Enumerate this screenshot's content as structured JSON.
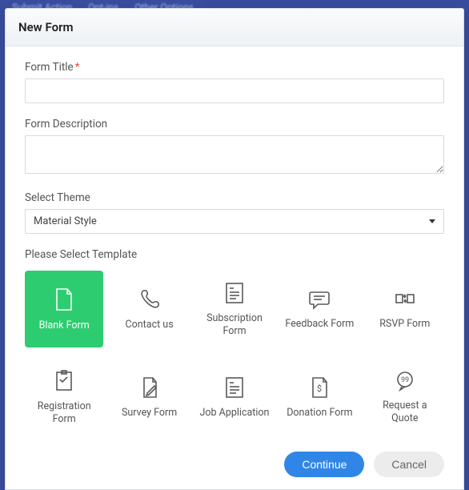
{
  "header": {
    "title": "New Form"
  },
  "fields": {
    "title": {
      "label": "Form Title",
      "required_mark": "*",
      "value": ""
    },
    "description": {
      "label": "Form Description",
      "value": ""
    },
    "theme": {
      "label": "Select Theme",
      "selected": "Material Style"
    }
  },
  "templates": {
    "label": "Please Select Template",
    "items": [
      {
        "label": "Blank Form",
        "selected": true
      },
      {
        "label": "Contact us",
        "selected": false
      },
      {
        "label": "Subscription Form",
        "selected": false
      },
      {
        "label": "Feedback Form",
        "selected": false
      },
      {
        "label": "RSVP Form",
        "selected": false
      },
      {
        "label": "Registration Form",
        "selected": false
      },
      {
        "label": "Survey Form",
        "selected": false
      },
      {
        "label": "Job Application",
        "selected": false
      },
      {
        "label": "Donation Form",
        "selected": false
      },
      {
        "label": "Request a Quote",
        "selected": false
      }
    ]
  },
  "footer": {
    "continue": "Continue",
    "cancel": "Cancel"
  }
}
